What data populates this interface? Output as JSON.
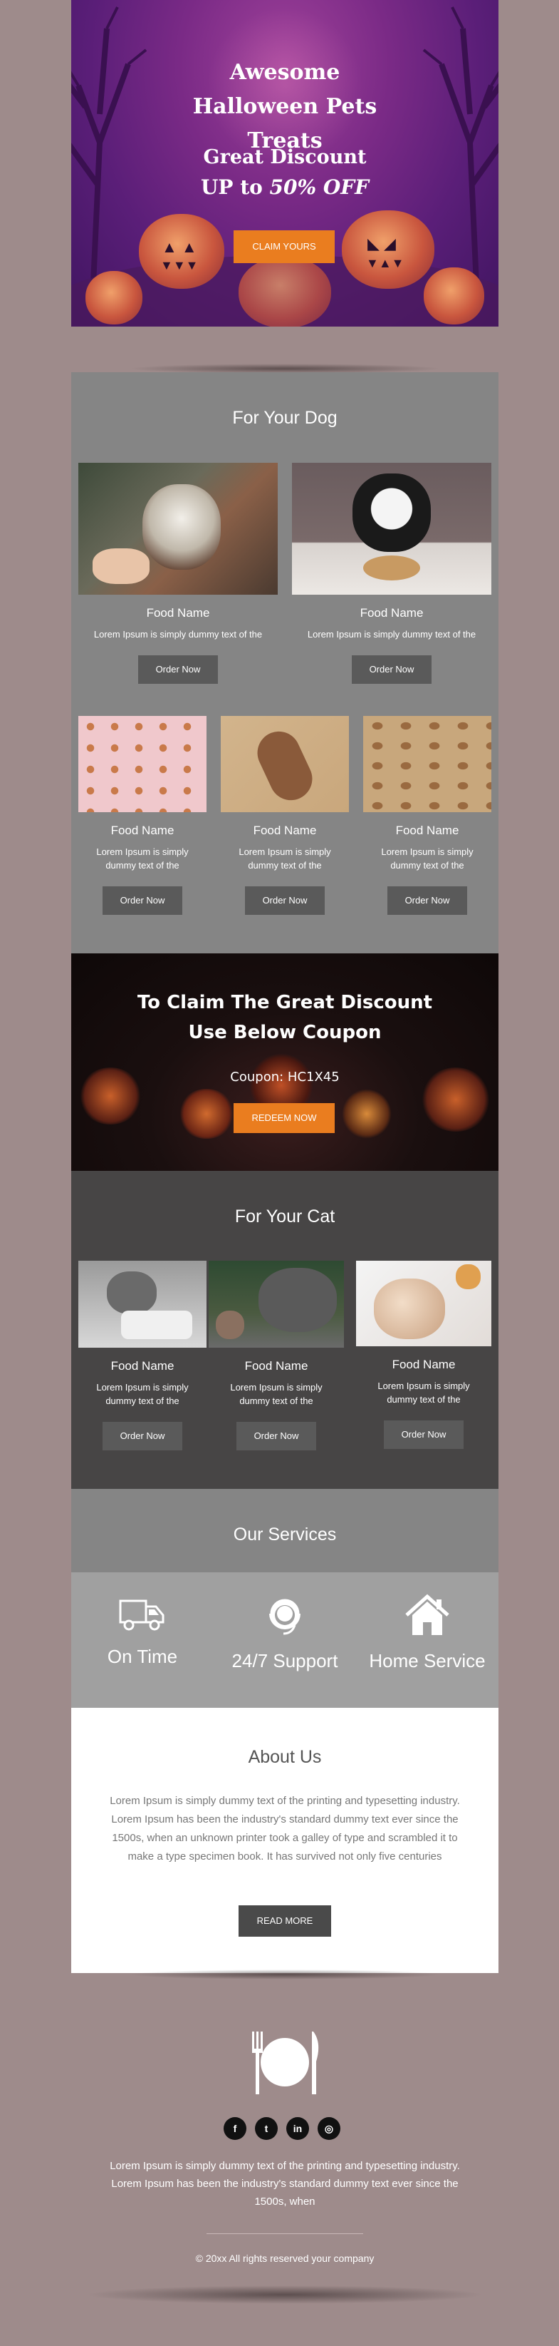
{
  "hero": {
    "title": "Awesome Halloween Pets Treats",
    "subtitle1": "Great Discount",
    "subtitle2_prefix": "UP to ",
    "subtitle2_emph": "50% OFF",
    "cta": "CLAIM YOURS"
  },
  "dog": {
    "title": "For Your Dog",
    "items": [
      {
        "name": "Food Name",
        "desc": "Lorem Ipsum is simply dummy text of the",
        "button": "Order Now"
      },
      {
        "name": "Food Name",
        "desc": "Lorem Ipsum is simply dummy text of the",
        "button": "Order Now"
      },
      {
        "name": "Food Name",
        "desc": "Lorem Ipsum is simply dummy text of the",
        "button": "Order Now"
      },
      {
        "name": "Food Name",
        "desc": "Lorem Ipsum is simply dummy text of the",
        "button": "Order Now"
      },
      {
        "name": "Food Name",
        "desc": "Lorem Ipsum is simply dummy text of the",
        "button": "Order Now"
      }
    ]
  },
  "coupon": {
    "title": "To Claim The Great Discount Use Below Coupon",
    "code": "Coupon: HC1X45",
    "button": "REDEEM NOW"
  },
  "cat": {
    "title": "For Your Cat",
    "items": [
      {
        "name": "Food Name",
        "desc": "Lorem Ipsum is simply dummy text of the",
        "button": "Order Now"
      },
      {
        "name": "Food Name",
        "desc": "Lorem Ipsum is simply dummy text of the",
        "button": "Order Now"
      },
      {
        "name": "Food Name",
        "desc": "Lorem Ipsum is simply dummy text of the",
        "button": "Order Now"
      }
    ]
  },
  "services": {
    "title": "Our Services",
    "items": [
      {
        "label": "On Time",
        "icon": "truck-icon"
      },
      {
        "label": "24/7 Support",
        "icon": "headset-icon"
      },
      {
        "label": "Home Service",
        "icon": "home-icon"
      }
    ]
  },
  "about": {
    "title": "About Us",
    "text": "Lorem Ipsum is simply dummy text of the printing and typesetting industry. Lorem Ipsum has been the industry's standard dummy text ever since the 1500s, when an unknown printer took a galley of type and scrambled it to make a type specimen book. It has survived not only five centuries",
    "button": "READ MORE"
  },
  "footer": {
    "logo_icon": "plate-cutlery-icon",
    "social": [
      "facebook-icon",
      "twitter-icon",
      "linkedin-icon",
      "instagram-icon"
    ],
    "text": "Lorem Ipsum is simply dummy text of the printing and typesetting industry. Lorem Ipsum has been the industry's standard dummy text ever since the 1500s, when",
    "copyright": "© 20xx All rights reserved your company"
  },
  "colors": {
    "page_bg": "#9e8b8b",
    "accent_orange": "#ea7d1f",
    "dog_bg": "#858585",
    "cat_bg": "#474545",
    "button_dark": "#5a5a5a"
  }
}
